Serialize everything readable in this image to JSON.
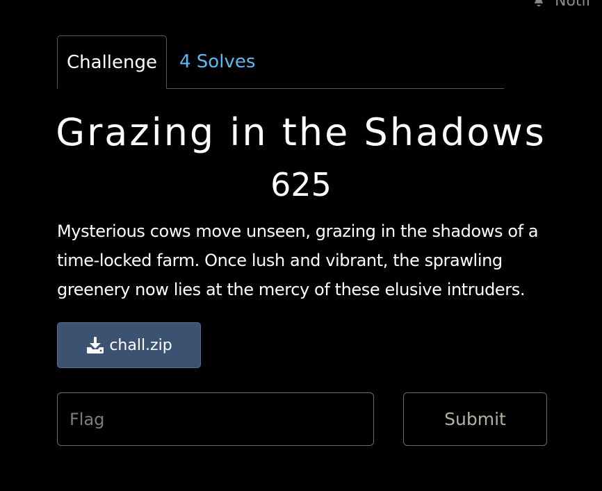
{
  "header": {
    "notifications_label": "Notif"
  },
  "tabs": [
    {
      "label": "Challenge",
      "active": true
    },
    {
      "label": "4 Solves",
      "active": false
    }
  ],
  "challenge": {
    "title": "Grazing in the Shadows",
    "points": "625",
    "description": "Mysterious cows move unseen, grazing in the shadows of a time-locked farm. Once lush and vibrant, the sprawling greenery now lies at the mercy of these elusive intruders.",
    "file_label": "chall.zip"
  },
  "form": {
    "flag_placeholder": "Flag",
    "flag_value": "",
    "submit_label": "Submit"
  },
  "icons": {
    "download": "download-icon",
    "notification": "bell-icon"
  },
  "colors": {
    "background": "#000000",
    "solves_link": "#5fb8f2",
    "download_button": "#3b5270",
    "submit_text": "#b6b09f"
  }
}
